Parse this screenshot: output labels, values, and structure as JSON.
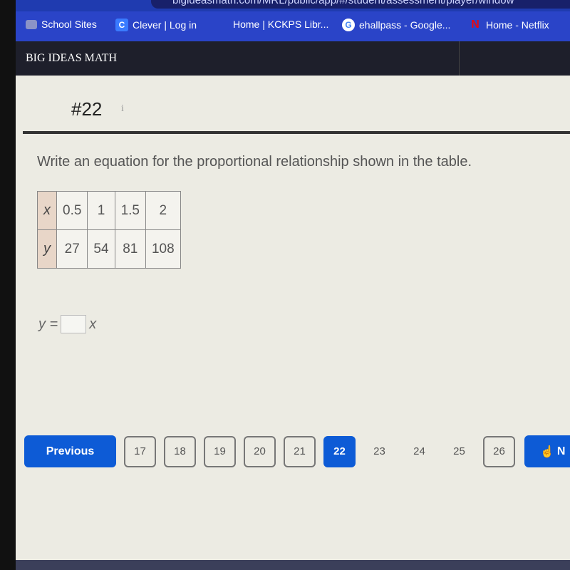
{
  "browser": {
    "url": "bigideasmath.com/MRL/public/app/#/student/assessment/player/window",
    "bookmarks": [
      {
        "label": "School Sites",
        "icon": "folder-icon"
      },
      {
        "label": "Clever | Log in",
        "icon": "clever-icon"
      },
      {
        "label": "Home | KCKPS Libr...",
        "icon": ""
      },
      {
        "label": "ehallpass - Google...",
        "icon": "google-icon"
      },
      {
        "label": "Home - Netflix",
        "icon": "netflix-icon"
      }
    ]
  },
  "app": {
    "brand": "BIG IDEAS MATH"
  },
  "question": {
    "number": "#22",
    "info": "i",
    "prompt": "Write an equation for the proportional relationship shown in the table.",
    "table": {
      "x_label": "x",
      "y_label": "y",
      "x": [
        "0.5",
        "1",
        "1.5",
        "2"
      ],
      "y": [
        "27",
        "54",
        "81",
        "108"
      ]
    },
    "equation": {
      "lhs": "y =",
      "answer": "",
      "rhs": "x"
    }
  },
  "pager": {
    "previous": "Previous",
    "pages": [
      {
        "n": "17",
        "state": "visited"
      },
      {
        "n": "18",
        "state": "visited"
      },
      {
        "n": "19",
        "state": "visited"
      },
      {
        "n": "20",
        "state": "visited"
      },
      {
        "n": "21",
        "state": "visited"
      },
      {
        "n": "22",
        "state": "active"
      },
      {
        "n": "23",
        "state": "plain"
      },
      {
        "n": "24",
        "state": "plain"
      },
      {
        "n": "25",
        "state": "plain"
      },
      {
        "n": "26",
        "state": "visited"
      }
    ],
    "next": "N"
  },
  "colors": {
    "accent": "#0d5bd6",
    "bookmark_bar": "#2a44c8",
    "app_bar": "#1e1f2b"
  }
}
